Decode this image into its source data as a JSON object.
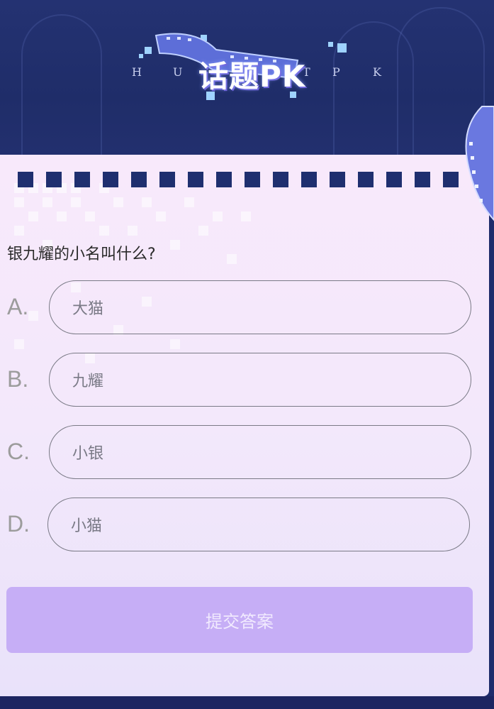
{
  "header": {
    "title": "话题PK",
    "letters": [
      "H",
      "U",
      "T",
      "P",
      "K"
    ]
  },
  "question": {
    "text": "银九耀的小名叫什么?"
  },
  "options": [
    {
      "letter": "A.",
      "label": "大猫"
    },
    {
      "letter": "B.",
      "label": "九耀"
    },
    {
      "letter": "C.",
      "label": "小银"
    },
    {
      "letter": "D.",
      "label": "小猫"
    }
  ],
  "submit": {
    "label": "提交答案"
  },
  "colors": {
    "header_bg": "#1f2d69",
    "card_bg": "#f3e8fb",
    "button_bg": "#c6aef6",
    "strip": "#1f2f6f"
  }
}
